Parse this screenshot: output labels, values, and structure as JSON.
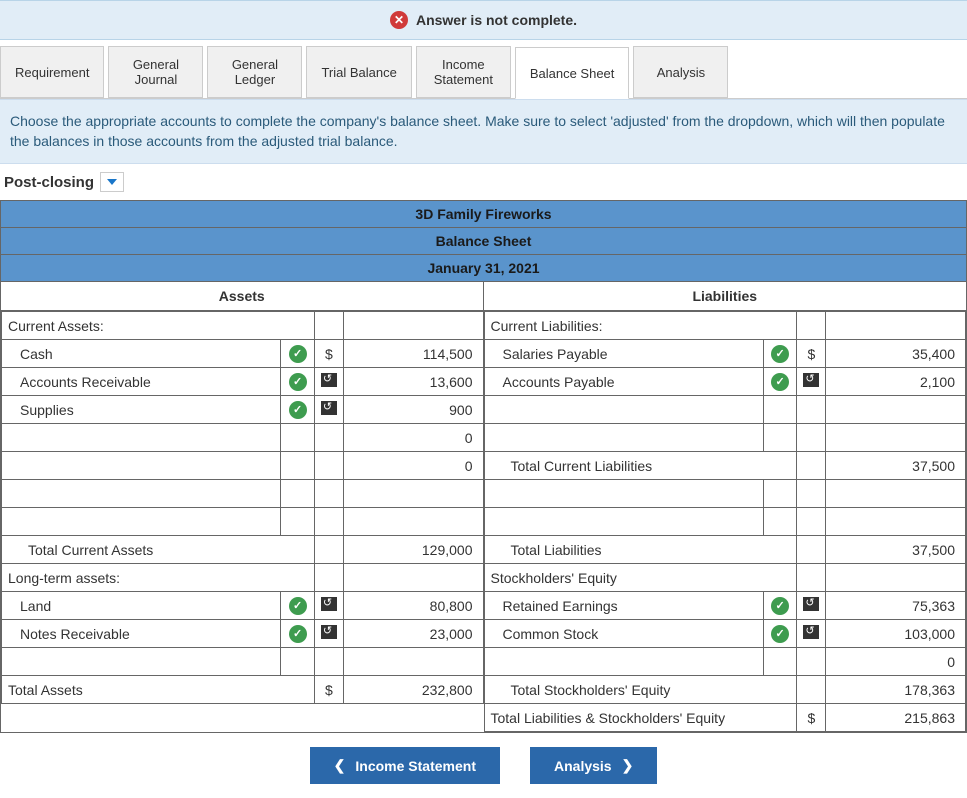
{
  "alert": {
    "text": "Answer is not complete."
  },
  "tabs": [
    {
      "label": "Requirement"
    },
    {
      "label": "General\nJournal"
    },
    {
      "label": "General\nLedger"
    },
    {
      "label": "Trial Balance"
    },
    {
      "label": "Income\nStatement"
    },
    {
      "label": "Balance Sheet",
      "active": true
    },
    {
      "label": "Analysis"
    }
  ],
  "instruction": "Choose the appropriate accounts to complete the company's balance sheet. Make sure to select 'adjusted' from the dropdown, which will then populate the balances in those accounts from the adjusted trial balance.",
  "dropdown": {
    "label": "Post-closing"
  },
  "sheet": {
    "company": "3D Family Fireworks",
    "title": "Balance Sheet",
    "date": "January 31, 2021",
    "left_header": "Assets",
    "right_header": "Liabilities",
    "assets": {
      "section1": "Current Assets:",
      "rows1": [
        {
          "label": "Cash",
          "check": true,
          "sym": "$",
          "val": "114,500"
        },
        {
          "label": "Accounts Receivable",
          "check": true,
          "flip": true,
          "val": "13,600"
        },
        {
          "label": "Supplies",
          "check": true,
          "flip": true,
          "val": "900"
        },
        {
          "label": "",
          "val": "0"
        },
        {
          "label": "",
          "val": "0"
        },
        {
          "label": "",
          "val": ""
        },
        {
          "label": "",
          "val": ""
        }
      ],
      "total1": {
        "label": "Total Current Assets",
        "val": "129,000"
      },
      "section2": "Long-term assets:",
      "rows2": [
        {
          "label": "Land",
          "check": true,
          "flip": true,
          "val": "80,800"
        },
        {
          "label": "Notes Receivable",
          "check": true,
          "flip": true,
          "val": "23,000"
        },
        {
          "label": "",
          "val": ""
        }
      ],
      "grand": {
        "label": "Total Assets",
        "sym": "$",
        "val": "232,800"
      }
    },
    "liab": {
      "section1": "Current Liabilities:",
      "rows1": [
        {
          "label": "Salaries Payable",
          "check": true,
          "sym": "$",
          "val": "35,400"
        },
        {
          "label": "Accounts Payable",
          "check": true,
          "flip": true,
          "val": "2,100"
        },
        {
          "label": "",
          "val": ""
        },
        {
          "label": "",
          "val": ""
        }
      ],
      "tcl": {
        "label": "Total Current Liabilities",
        "val": "37,500"
      },
      "blank_rows": [
        "",
        ""
      ],
      "tl": {
        "label": "Total Liabilities",
        "val": "37,500"
      },
      "section2": "Stockholders' Equity",
      "rows2": [
        {
          "label": "Retained Earnings",
          "check": true,
          "flip": true,
          "val": "75,363"
        },
        {
          "label": "Common Stock",
          "check": true,
          "flip": true,
          "val": "103,000"
        },
        {
          "label": "",
          "val": "0"
        }
      ],
      "tse": {
        "label": "Total Stockholders' Equity",
        "val": "178,363"
      },
      "grand": {
        "label": "Total Liabilities & Stockholders' Equity",
        "sym": "$",
        "val": "215,863"
      }
    }
  },
  "nav": {
    "prev": "Income Statement",
    "next": "Analysis"
  }
}
